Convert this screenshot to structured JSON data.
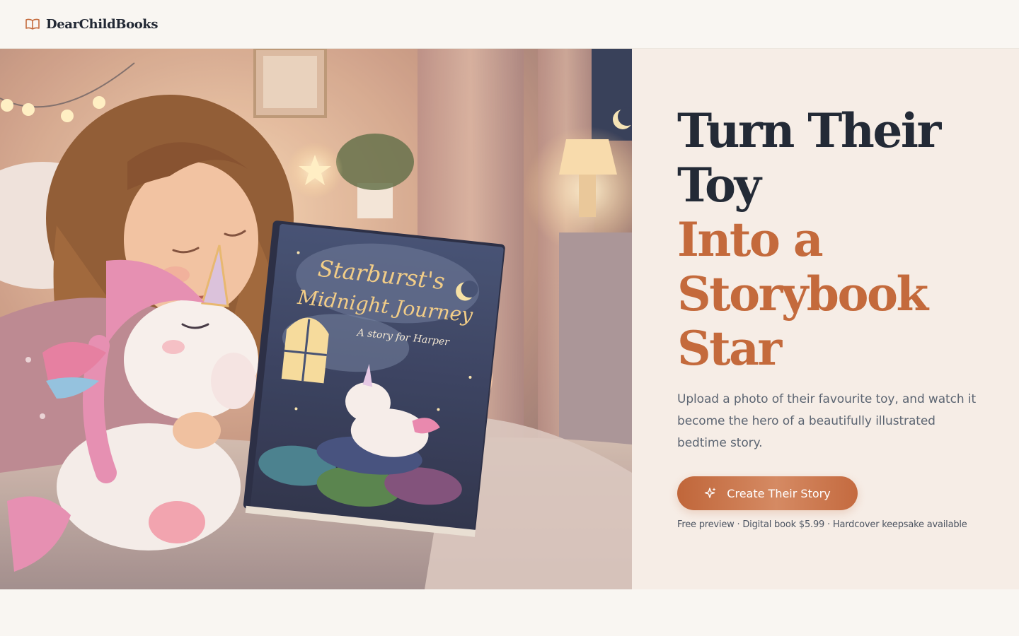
{
  "header": {
    "brand": "DearChildBooks",
    "logo_icon": "open-book-icon"
  },
  "hero": {
    "image": {
      "book_title_line1": "Starburst's",
      "book_title_line2": "Midnight Journey",
      "book_subtitle": "A story for Harper"
    },
    "headline_dark": [
      "Turn Their",
      "Toy"
    ],
    "headline_accent": [
      "Into a",
      "Storybook",
      "Star"
    ],
    "subcopy": "Upload a photo of their favourite toy, and watch it become the hero of a beautifully illustrated bedtime story.",
    "cta_label": "Create Their Story",
    "cta_icon": "sparkles-icon",
    "pricing": "Free preview · Digital book $5.99 · Hardcover keepsake available"
  },
  "colors": {
    "background": "#f9f6f2",
    "panel": "#f6ede6",
    "heading": "#232a36",
    "accent": "#c46a3c",
    "body_text": "#5c6572"
  }
}
